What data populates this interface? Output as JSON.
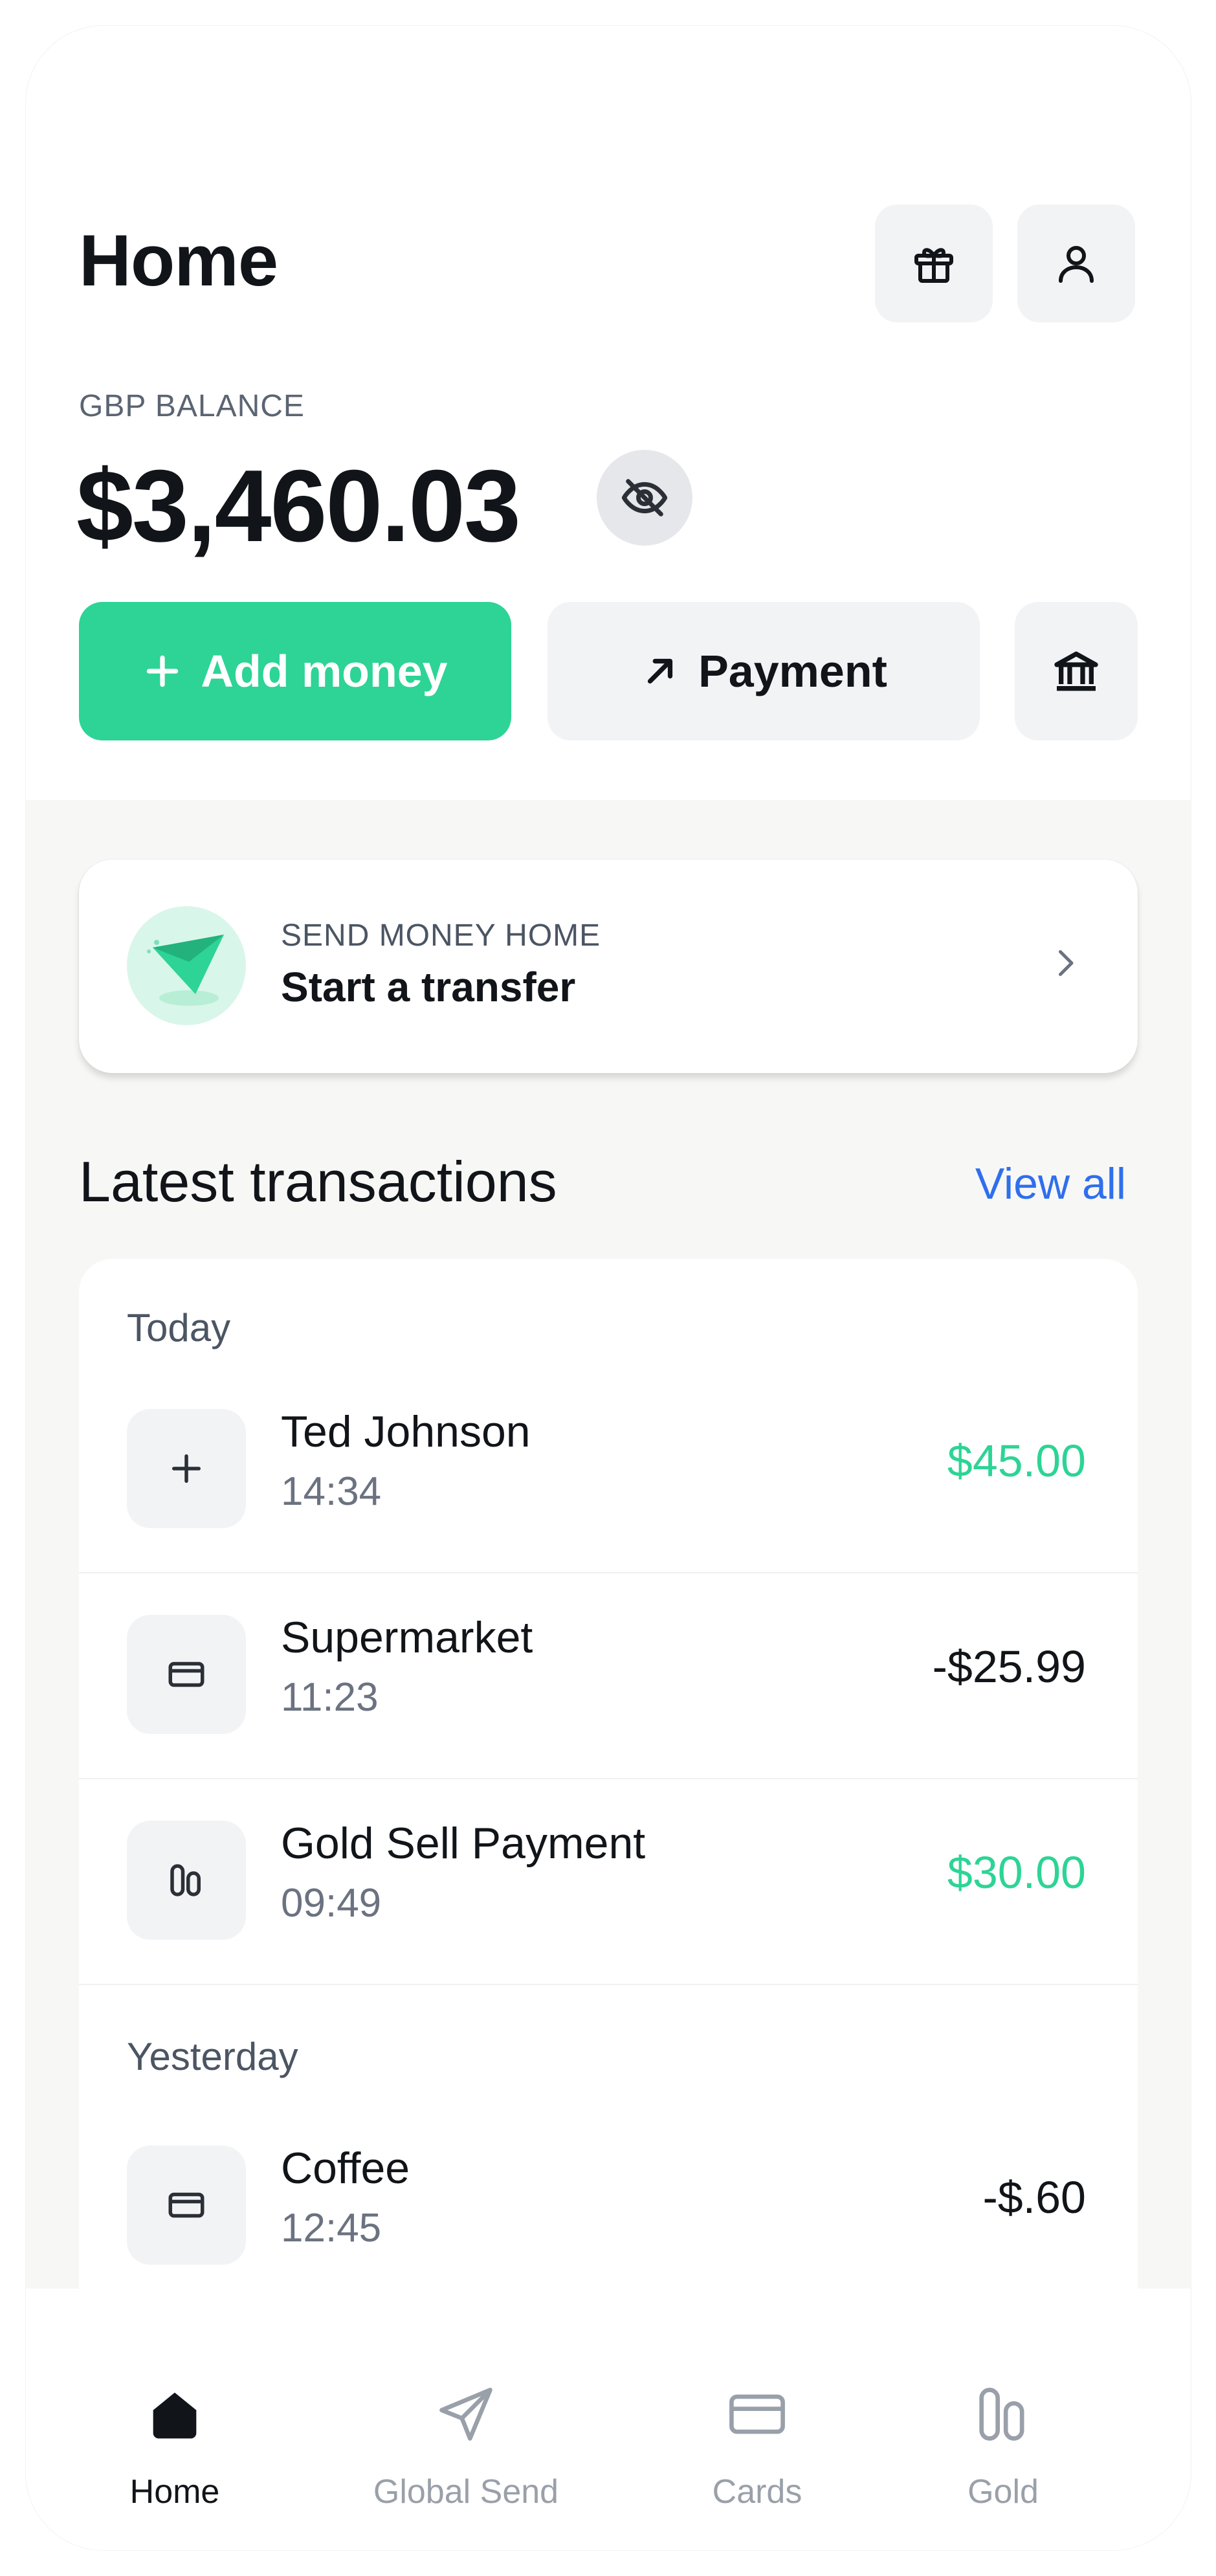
{
  "header": {
    "title": "Home"
  },
  "balance": {
    "label": "GBP BALANCE",
    "amount": "$3,460.03"
  },
  "actions": {
    "add_money": "Add money",
    "payment": "Payment"
  },
  "promo": {
    "eyebrow": "SEND MONEY HOME",
    "title": "Start a transfer"
  },
  "transactions": {
    "title": "Latest transactions",
    "view_all": "View all",
    "groups": [
      {
        "label": "Today",
        "items": [
          {
            "name": "Ted Johnson",
            "time": "14:34",
            "amount": "$45.00",
            "icon": "plus-icon"
          },
          {
            "name": "Supermarket",
            "time": "11:23",
            "amount": "-$25.99",
            "icon": "card-icon"
          },
          {
            "name": "Gold Sell Payment",
            "time": "09:49",
            "amount": "$30.00",
            "icon": "gold-bars-icon"
          }
        ]
      },
      {
        "label": "Yesterday",
        "items": [
          {
            "name": "Coffee",
            "time": "12:45",
            "amount": "-$.60",
            "icon": "card-icon"
          }
        ]
      }
    ]
  },
  "tabbar": {
    "items": [
      {
        "label": "Home",
        "icon": "home-icon",
        "active": true
      },
      {
        "label": "Global Send",
        "icon": "send-icon",
        "active": false
      },
      {
        "label": "Cards",
        "icon": "card-icon",
        "active": false
      },
      {
        "label": "Gold",
        "icon": "gold-bars-icon",
        "active": false
      }
    ]
  },
  "colors": {
    "accent": "#2dd495",
    "link": "#2f6fed",
    "positive": "#2dd495",
    "text": "#111418",
    "panel": "#f7f7f6"
  }
}
